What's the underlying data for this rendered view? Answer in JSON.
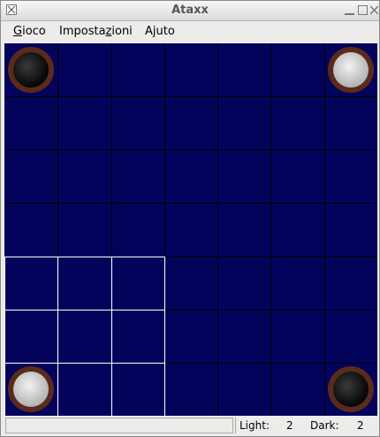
{
  "window": {
    "title": "Ataxx"
  },
  "menu": {
    "items": [
      {
        "label": "Gioco",
        "mnemonic": "G",
        "rest": "ioco"
      },
      {
        "label": "Impostazioni",
        "pre": "Imposta",
        "mnemonic": "z",
        "rest": "ioni"
      },
      {
        "label": "Ajuto",
        "pre": "A",
        "mnemonic": "j",
        "rest": "uto"
      }
    ]
  },
  "board": {
    "cells": 7,
    "pieces": [
      {
        "row": 0,
        "col": 0,
        "color": "dark"
      },
      {
        "row": 0,
        "col": 6,
        "color": "light"
      },
      {
        "row": 6,
        "col": 0,
        "color": "light"
      },
      {
        "row": 6,
        "col": 6,
        "color": "dark"
      }
    ],
    "highlight": {
      "row_start": 4,
      "col_start": 0,
      "rows": 3,
      "cols": 3
    },
    "colors": {
      "background": "#03035c",
      "grid": "#000000",
      "highlight": "#ffffff"
    }
  },
  "status": {
    "message": "",
    "light_label": "Light:",
    "light_count": "2",
    "dark_label": "Dark:",
    "dark_count": "2"
  }
}
